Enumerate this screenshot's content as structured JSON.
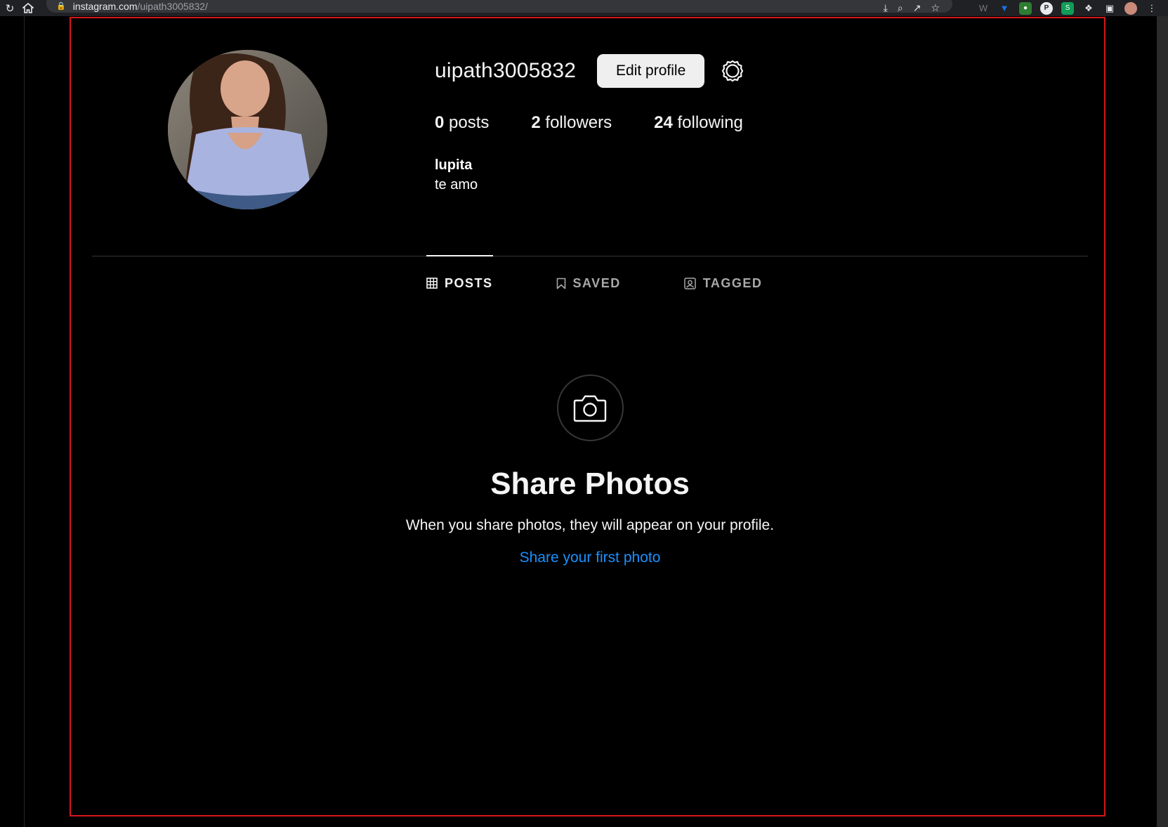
{
  "browser": {
    "url_host": "instagram.com",
    "url_path": "/uipath3005832/"
  },
  "profile": {
    "username": "uipath3005832",
    "edit_button": "Edit profile",
    "stats": {
      "posts_count": "0",
      "posts_label": " posts",
      "followers_count": "2",
      "followers_label": " followers",
      "following_count": "24",
      "following_label": " following"
    },
    "bio_name": "lupita",
    "bio_text": "te amo"
  },
  "tabs": [
    {
      "label": "POSTS",
      "icon": "grid-icon",
      "active": true
    },
    {
      "label": "SAVED",
      "icon": "bookmark-icon",
      "active": false
    },
    {
      "label": "TAGGED",
      "icon": "tagged-icon",
      "active": false
    }
  ],
  "empty_state": {
    "title": "Share Photos",
    "text": "When you share photos, they will appear on your profile.",
    "link": "Share your first photo"
  },
  "colors": {
    "background": "#000000",
    "link": "#1a91ff",
    "frame": "#d6161c"
  }
}
